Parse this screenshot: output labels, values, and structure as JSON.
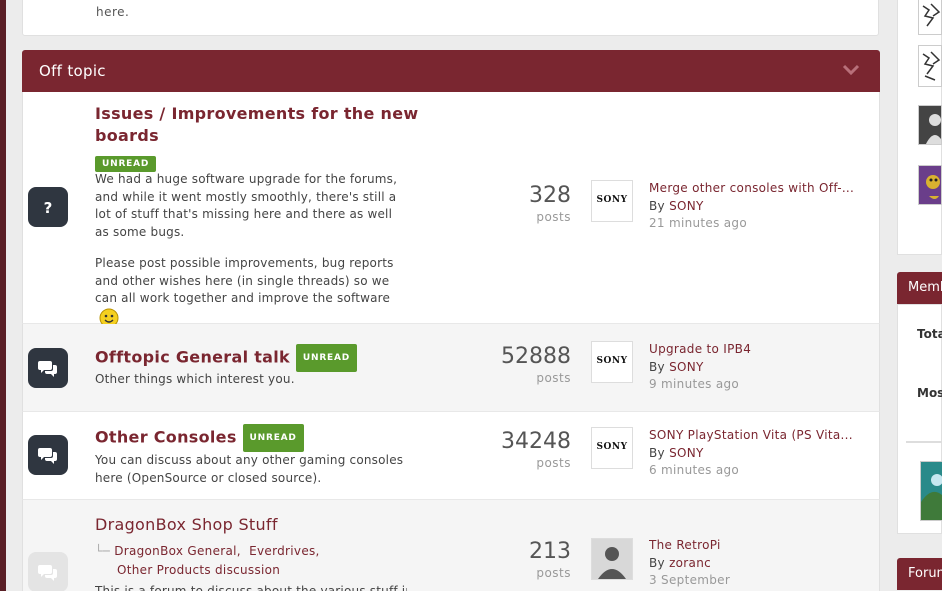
{
  "top_card": {
    "text": "here."
  },
  "category": {
    "title": "Off topic"
  },
  "forums": [
    {
      "title": "Issues / Improvements for the new boards",
      "title_line1": "Issues / Improvements for the new",
      "title_line2": "boards",
      "badge": "UNREAD",
      "desc_p1": "We had a huge software upgrade for the forums, and while it went mostly smoothly, there's still a lot of stuff that's missing here and there as well as some bugs.",
      "desc_p2": "Please post possible improvements, bug reports and other wishes here (in single threads) so we can all work together and improve the software",
      "icon": "question-icon",
      "posts": "328",
      "posts_label": "posts",
      "last_title": "Merge other consoles with Off-...",
      "by_prefix": "By",
      "last_by": "SONY",
      "last_time": "21 minutes ago",
      "avatar": "SONY"
    },
    {
      "title": "Offtopic General talk",
      "badge": "UNREAD",
      "desc": "Other things which interest you.",
      "icon": "chat-bubbles-icon",
      "posts": "52888",
      "posts_label": "posts",
      "last_title": "Upgrade to IPB4",
      "by_prefix": "By",
      "last_by": "SONY",
      "last_time": "9 minutes ago",
      "avatar": "SONY"
    },
    {
      "title": "Other Consoles",
      "badge": "UNREAD",
      "desc": "You can discuss about any other gaming consoles here (OpenSource or closed source).",
      "icon": "chat-bubbles-icon",
      "posts": "34248",
      "posts_label": "posts",
      "last_title": "SONY PlayStation Vita (PS Vita...",
      "by_prefix": "By",
      "last_by": "SONY",
      "last_time": "6 minutes ago",
      "avatar": "SONY"
    },
    {
      "title": "DragonBox Shop Stuff",
      "subforums": [
        "DragonBox General,",
        "Everdrives,",
        "Other Products discussion"
      ],
      "desc": "This is a forum to discuss about the various stuff in",
      "icon": "chat-bubbles-icon",
      "posts": "213",
      "posts_label": "posts",
      "last_title": "The RetroPi",
      "by_prefix": "By",
      "last_by": "zoranc",
      "last_time": "3 September"
    }
  ],
  "sidebar": {
    "members_header": "Members",
    "total_label": "Total",
    "most_label": "Most",
    "forum_header": "Forum"
  },
  "colors": {
    "brand": "#7a2630",
    "badge": "#5a9a2c",
    "icon_bg": "#2f3640"
  }
}
